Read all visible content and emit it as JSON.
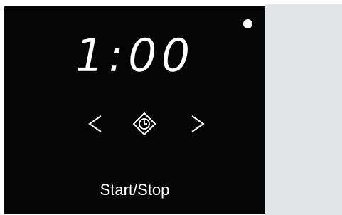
{
  "display": {
    "time": "1:00",
    "start_stop_label": "Start/Stop"
  },
  "icons": {
    "previous": "chevron-left-icon",
    "timer": "clock-icon",
    "next": "chevron-right-icon",
    "indicator": "status-dot-icon"
  },
  "colors": {
    "display_background": "#050505",
    "display_text": "#ffffff",
    "side_panel": "#e3e4e6"
  }
}
